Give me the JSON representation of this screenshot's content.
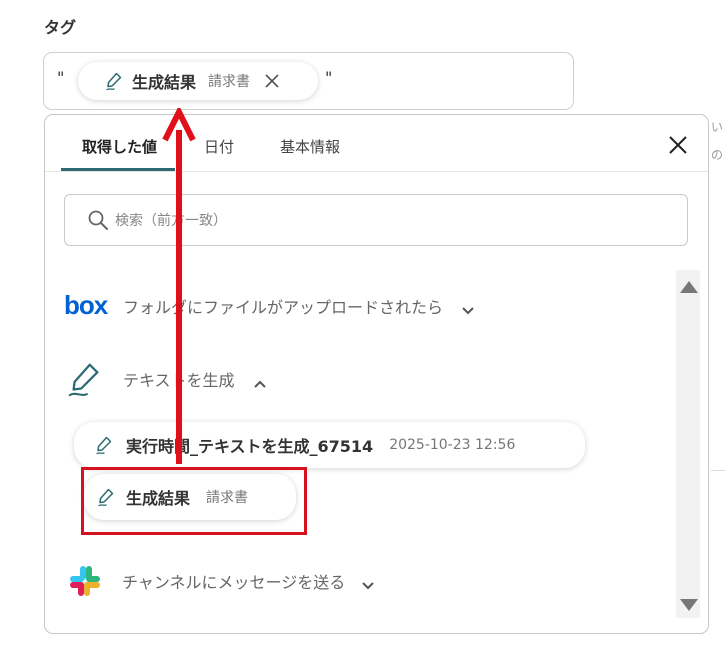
{
  "field": {
    "label": "タグ"
  },
  "tag_input": {
    "quote_open": "\"",
    "quote_close": "\"",
    "token": {
      "title": "生成結果",
      "subtitle": "請求書",
      "icon": "pen-icon"
    }
  },
  "picker": {
    "tabs": [
      {
        "label": "取得した値",
        "active": true
      },
      {
        "label": "日付",
        "active": false
      },
      {
        "label": "基本情報",
        "active": false
      }
    ],
    "search_placeholder": "検索（前方一致）",
    "sections": [
      {
        "label": "フォルダにファイルがアップロードされたら",
        "icon": "box-logo-icon",
        "logo_text": "box",
        "expanded": false
      },
      {
        "label": "テキストを生成",
        "icon": "pen-icon",
        "expanded": true,
        "items": [
          {
            "title": "実行時間_テキストを生成_67514",
            "subtitle": "2025-10-23 12:56",
            "icon": "pen-icon"
          },
          {
            "title": "生成結果",
            "subtitle": "請求書",
            "icon": "pen-icon",
            "highlighted": true
          }
        ]
      },
      {
        "label": "チャンネルにメッセージを送る",
        "icon": "slack-logo-icon",
        "expanded": false
      }
    ]
  },
  "background_text": {
    "line1": "い",
    "line2": "の"
  },
  "colors": {
    "accent": "#2d6b73",
    "arrow": "#e0101a",
    "highlight_box": "#d7121f",
    "box_brand": "#0061d5"
  }
}
